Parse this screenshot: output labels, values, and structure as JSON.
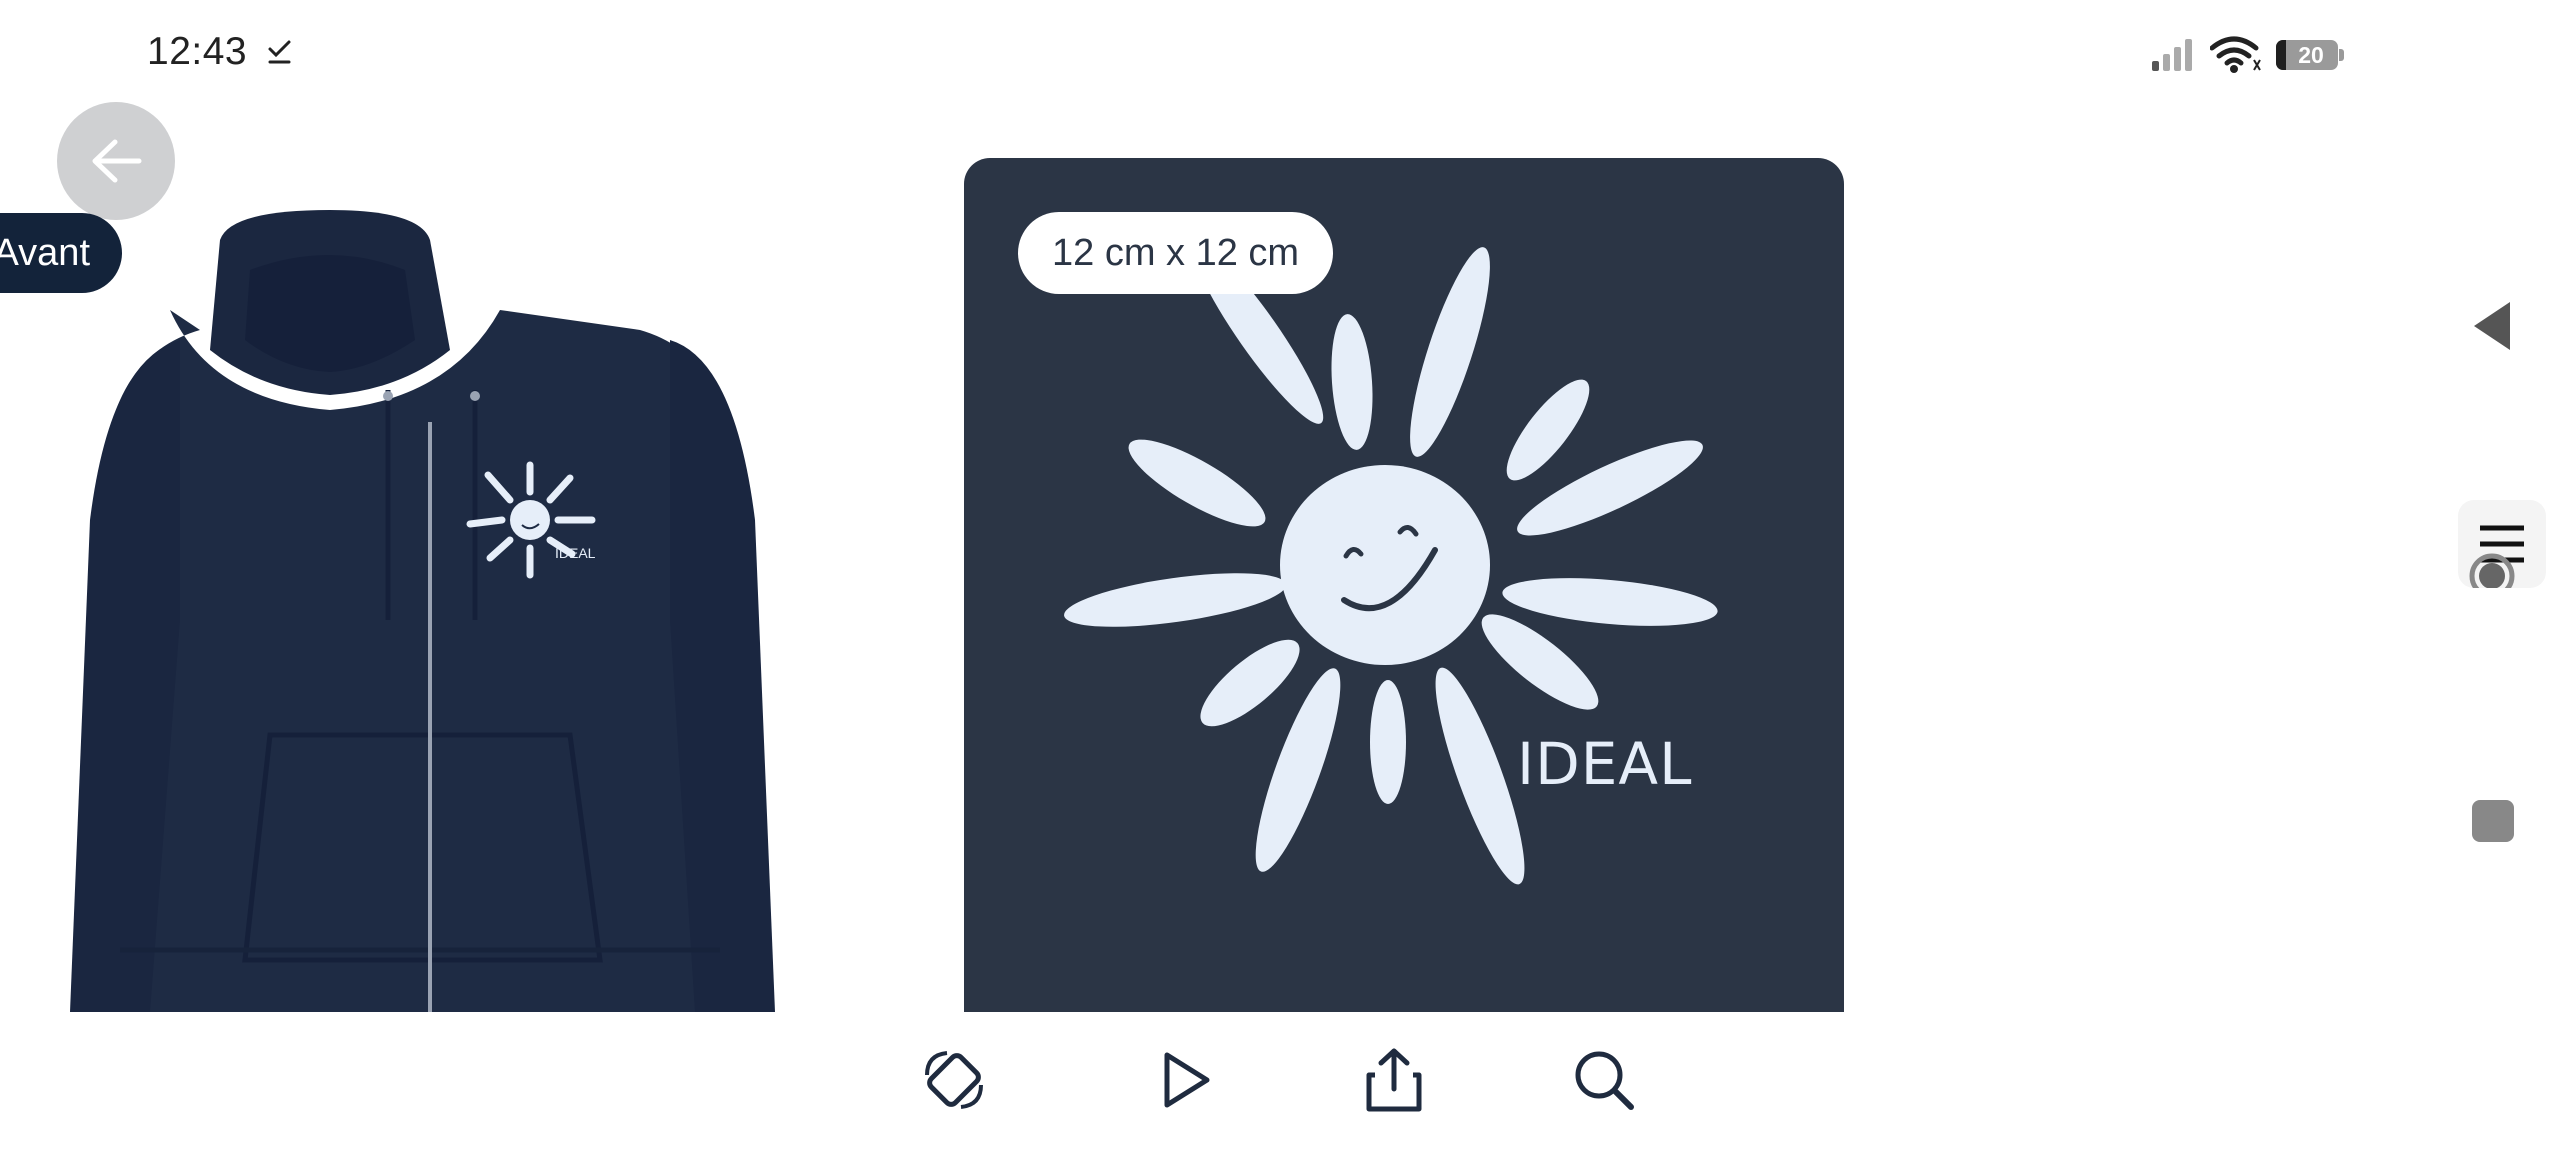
{
  "status_bar": {
    "time": "12:43",
    "battery": "20",
    "icons": [
      "download-done-icon",
      "signal-icon",
      "wifi-icon",
      "battery-icon"
    ]
  },
  "product": {
    "side_label": "Avant",
    "design_size": "12 cm x 12 cm",
    "design_logo_text": "IDEAL"
  },
  "toolbar": {
    "icons": [
      "rotate-icon",
      "play-icon",
      "share-icon",
      "search-icon"
    ]
  },
  "colors": {
    "navy_badge": "#13233a",
    "design_bg": "#2b3545",
    "sun": "#e6eef9",
    "hoodie": "#1e2b44"
  }
}
